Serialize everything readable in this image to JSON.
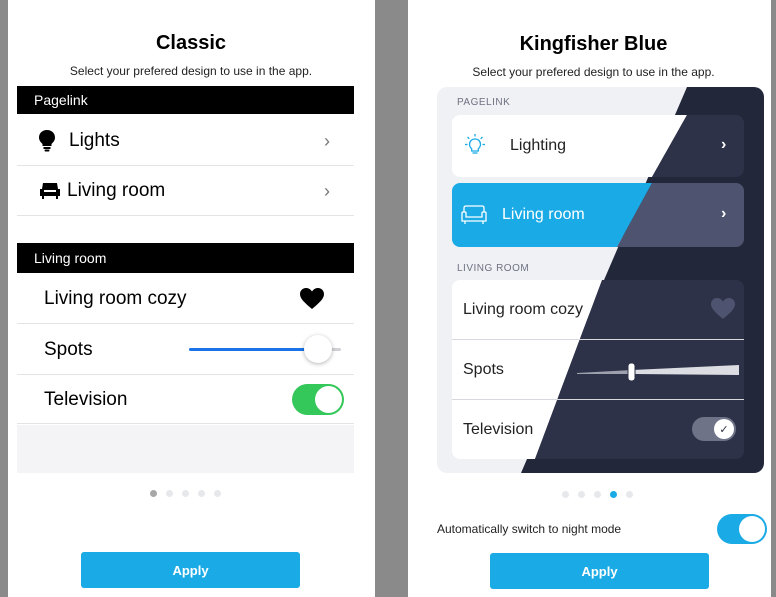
{
  "classic": {
    "title": "Classic",
    "subtitle": "Select your prefered design to use in the app.",
    "pagelink_header": "Pagelink",
    "pagelink_items": [
      {
        "label": "Lights",
        "icon": "lightbulb-icon"
      },
      {
        "label": "Living room",
        "icon": "sofa-icon"
      }
    ],
    "room_header": "Living room",
    "room_items": [
      {
        "label": "Living room cozy",
        "control": "favorite",
        "icon": "heart-icon"
      },
      {
        "label": "Spots",
        "control": "slider",
        "value_fraction": 0.85
      },
      {
        "label": "Television",
        "control": "toggle",
        "on": true
      }
    ],
    "pager": {
      "count": 5,
      "active_index": 0
    },
    "apply_label": "Apply"
  },
  "kingfisher": {
    "title": "Kingfisher Blue",
    "subtitle": "Select your prefered design to use in the app.",
    "pagelink_header": "PAGELINK",
    "pagelink_items": [
      {
        "label": "Lighting",
        "icon": "lightbulb-icon"
      },
      {
        "label": "Living room",
        "icon": "sofa-icon",
        "highlighted": true
      }
    ],
    "room_header": "LIVING ROOM",
    "room_items": [
      {
        "label": "Living room cozy",
        "control": "favorite",
        "icon": "heart-icon"
      },
      {
        "label": "Spots",
        "control": "slider",
        "value_fraction": 0.25
      },
      {
        "label": "Television",
        "control": "toggle",
        "on": true
      }
    ],
    "pager": {
      "count": 5,
      "active_index": 3
    },
    "night_mode_label": "Automatically switch to night mode",
    "night_mode_on": true,
    "apply_label": "Apply"
  },
  "colors": {
    "accent_blue": "#1aabe6",
    "toggle_green": "#34c759",
    "dark_surface": "#23273a",
    "dark_card": "#4e5370",
    "black_header": "#000000"
  }
}
